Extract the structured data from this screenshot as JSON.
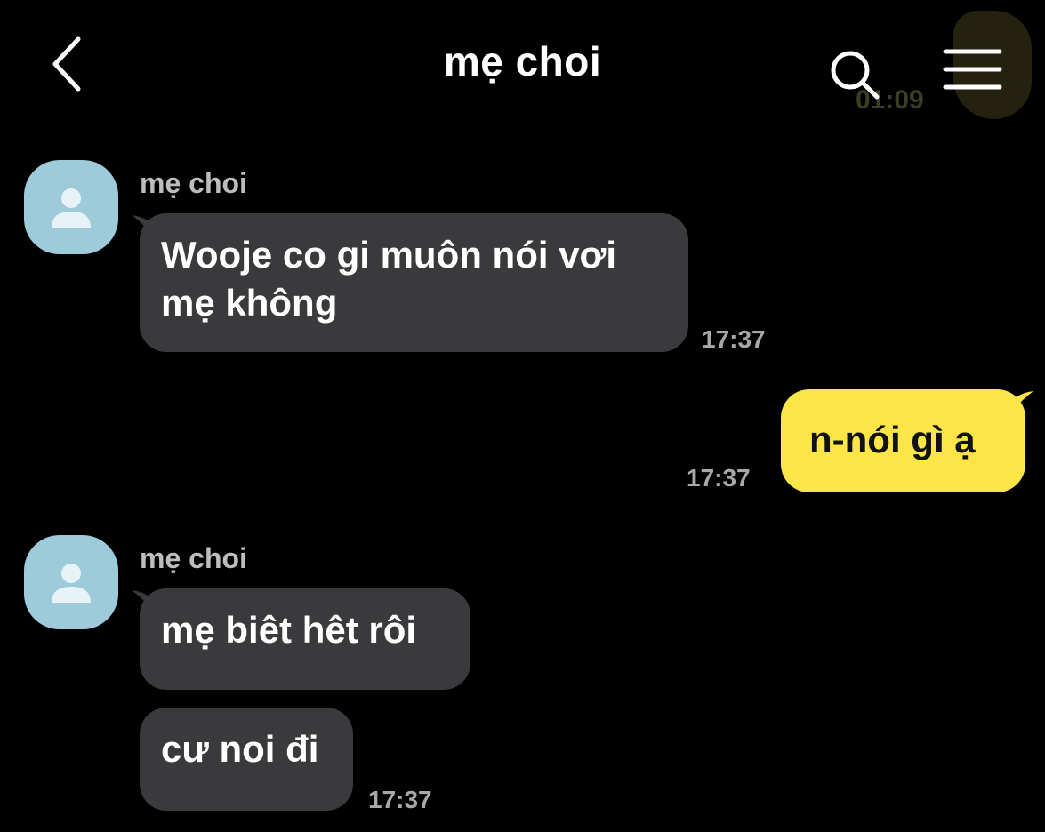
{
  "header": {
    "title": "mẹ choi",
    "ghost_time": "01:09"
  },
  "icons": {
    "back": "chevron-left-icon",
    "search": "search-icon",
    "menu": "hamburger-menu-icon",
    "avatar": "person-icon"
  },
  "colors": {
    "background": "#000000",
    "incoming_bubble": "#3a3a3c",
    "outgoing_bubble": "#fbe547",
    "avatar_bg": "#9ecbd9"
  },
  "messages": [
    {
      "sender": "mẹ choi",
      "bubbles": [
        "Wooje co gi muôn nói vơi mẹ không"
      ],
      "time": "17:37"
    },
    {
      "sender": "me",
      "bubbles": [
        "n-nói gì ạ"
      ],
      "time": "17:37"
    },
    {
      "sender": "mẹ choi",
      "bubbles": [
        "mẹ biêt hêt rôi",
        "cư noi đi"
      ],
      "time": "17:37"
    }
  ]
}
